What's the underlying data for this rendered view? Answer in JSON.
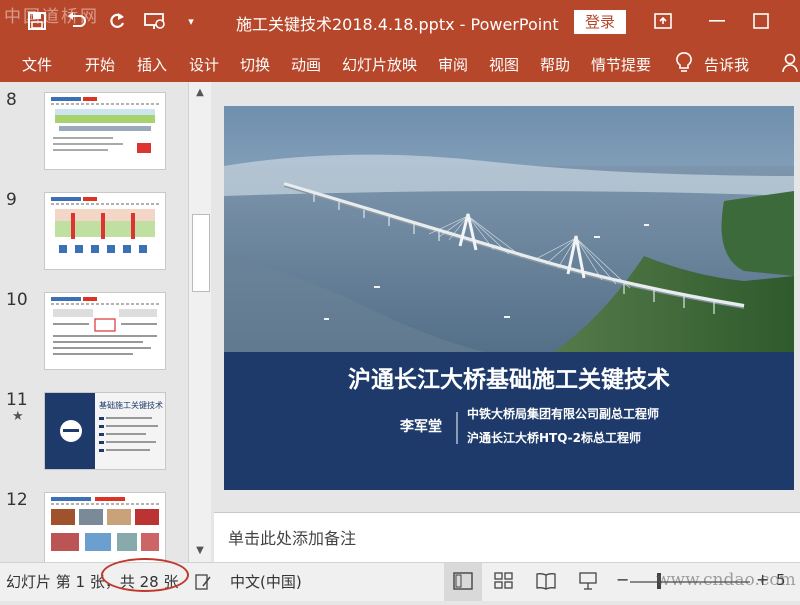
{
  "watermark_top": "中国道桥网",
  "watermark_bottom": "www.cndao.com",
  "titlebar": {
    "doc_title": "施工关键技术2018.4.18.pptx  -  PowerPoint",
    "login_label": "登录"
  },
  "tabs": [
    "文件",
    "开始",
    "插入",
    "设计",
    "切换",
    "动画",
    "幻灯片放映",
    "审阅",
    "视图",
    "帮助",
    "情节提要"
  ],
  "tell_me": "告诉我",
  "thumbnails": [
    {
      "number": "8",
      "star": ""
    },
    {
      "number": "9",
      "star": ""
    },
    {
      "number": "10",
      "star": ""
    },
    {
      "number": "11",
      "star": "★"
    },
    {
      "number": "12",
      "star": ""
    }
  ],
  "thumb11_title": "基础施工关键技术",
  "slide": {
    "title": "沪通长江大桥基础施工关键技术",
    "presenter": "李军堂",
    "role_line1": "中铁大桥局集团有限公司副总工程师",
    "role_line2": "沪通长江大桥HTQ-2标总工程师"
  },
  "notes_placeholder": "单击此处添加备注",
  "status": {
    "slide_info": "幻灯片 第 1 张，共 28 张",
    "language": "中文(中国)",
    "zoom_level": "5"
  },
  "colors": {
    "ribbon": "#b7472a",
    "slide_title_band": "#1e3a6b",
    "circle_annotation": "#c0392b"
  }
}
